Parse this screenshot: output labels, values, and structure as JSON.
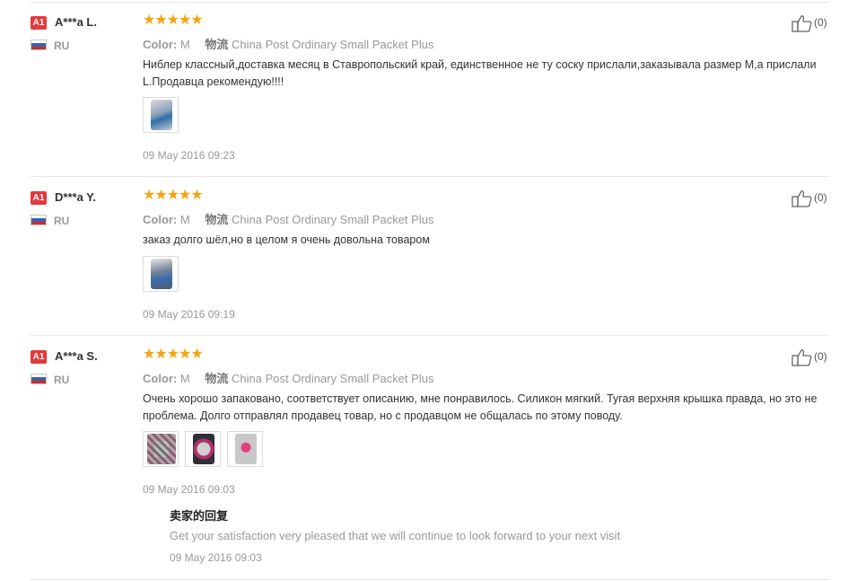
{
  "reviews": [
    {
      "badge": "A1",
      "name": "A***a L.",
      "country": "RU",
      "stars": "★★★★★",
      "color_label": "Color:",
      "color_value": "M",
      "logistics_label": "物流",
      "logistics_value": "China Post Ordinary Small Packet Plus",
      "text": "Ниблер классный,доставка месяц в Ставропольский край, единственное не ту соску прислали,заказывала размер М,а прислали L.Продавца рекомендую!!!!",
      "date": "09 May 2016 09:23",
      "likes": "(0)"
    },
    {
      "badge": "A1",
      "name": "D***a Y.",
      "country": "RU",
      "stars": "★★★★★",
      "color_label": "Color:",
      "color_value": "M",
      "logistics_label": "物流",
      "logistics_value": "China Post Ordinary Small Packet Plus",
      "text": "заказ долго шёл,но в целом я очень довольна товаром",
      "date": "09 May 2016 09:19",
      "likes": "(0)"
    },
    {
      "badge": "A1",
      "name": "A***a S.",
      "country": "RU",
      "stars": "★★★★★",
      "color_label": "Color:",
      "color_value": "M",
      "logistics_label": "物流",
      "logistics_value": "China Post Ordinary Small Packet Plus",
      "text": "Очень хорошо запаковано, соответствует описанию, мне понравилось. Силикон мягкий. Тугая верхняя крышка правда, но это не проблема. Долго отправлял продавец товар, но с продавцом не общалась по этому поводу.",
      "date": "09 May 2016 09:03",
      "likes": "(0)",
      "reply": {
        "title": "卖家的回复",
        "text": "Get your satisfaction very pleased that we will continue to look forward to your next visit",
        "date": "09 May 2016 09:03"
      }
    }
  ],
  "colors": {
    "badge": "#e4393c",
    "star": "#f7a311",
    "muted": "#999999"
  }
}
